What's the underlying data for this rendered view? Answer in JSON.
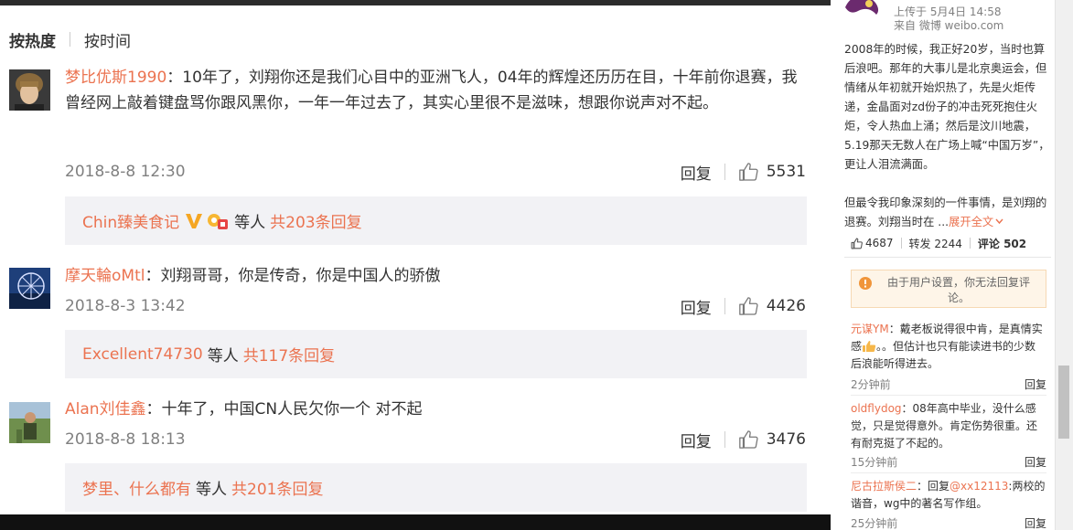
{
  "sort_tabs": {
    "hot": "按热度",
    "time": "按时间"
  },
  "comments": [
    {
      "user": "梦比优斯1990",
      "separator": "：",
      "text": "10年了，刘翔你还是我们心目中的亚洲飞人，04年的辉煌还历历在目，十年前你退赛，我曾经网上敲着键盘骂你跟风黑你，一年一年过去了，其实心里很不是滋味，想跟你说声对不起。",
      "date": "2018-8-8 12:30",
      "reply_label": "回复",
      "likes": "5531",
      "sub": {
        "user": "Chin臻美食记",
        "mid": "等人",
        "total": "共203条回复"
      }
    },
    {
      "user": "摩天輪oMtl",
      "separator": "：",
      "text": "刘翔哥哥，你是传奇，你是中国人的骄傲",
      "date": "2018-8-3 13:42",
      "reply_label": "回复",
      "likes": "4426",
      "sub": {
        "user": "Excellent74730",
        "mid": "等人",
        "total": "共117条回复"
      }
    },
    {
      "user": "Alan刘佳鑫",
      "separator": "：",
      "text": "十年了，中国CN人民欠你一个 对不起",
      "date": "2018-8-8 18:13",
      "reply_label": "回复",
      "likes": "3476",
      "sub": {
        "user": "梦里、什么都有",
        "mid": "等人",
        "total": "共201条回复"
      }
    }
  ],
  "post": {
    "uploaded": "上传于 5月4日 14:58",
    "source": "来自 微博 weibo.com",
    "para1": "2008年的时候，我正好20岁，当时也算后浪吧。那年的大事儿是北京奥运会，但情绪从年初就开始炽热了，先是火炬传递，金晶面对zd份子的冲击死死抱住火炬，令人热血上涌；然后是汶川地震，5.19那天无数人在广场上喊“中国万岁”，更让人泪流满面。",
    "para2": "但最令我印象深刻的一件事情，是刘翔的退赛。刘翔当时在 ...",
    "expand": "展开全文",
    "likes": "4687",
    "reposts": "转发 2244",
    "comments": "评论 502",
    "notice": "由于用户设置，你无法回复评论。"
  },
  "right_comments": [
    {
      "user": "元谋YM",
      "text_a": "：戴老板说得很中肯，是真情实感",
      "text_b": "。。但估计也只有能读进书的少数后浪能听得进去。",
      "time": "2分钟前",
      "reply": "回复"
    },
    {
      "user": "oldflydog",
      "text_a": "：08年高中毕业，没什么感觉，只是觉得意外。肯定伤势很重。还有耐克挺了不起的。",
      "text_b": "",
      "time": "15分钟前",
      "reply": "回复"
    },
    {
      "user": "尼古拉斯侯二",
      "text_a": "：回复",
      "mention": "@xx12113",
      "text_b": ":两校的谐音，wg中的著名写作组。",
      "time": "25分钟前",
      "reply": "回复"
    }
  ],
  "colors": {
    "accent": "#eb7350",
    "subbox_bg": "#f2f2f5",
    "notice_bg": "#fef5e8"
  }
}
